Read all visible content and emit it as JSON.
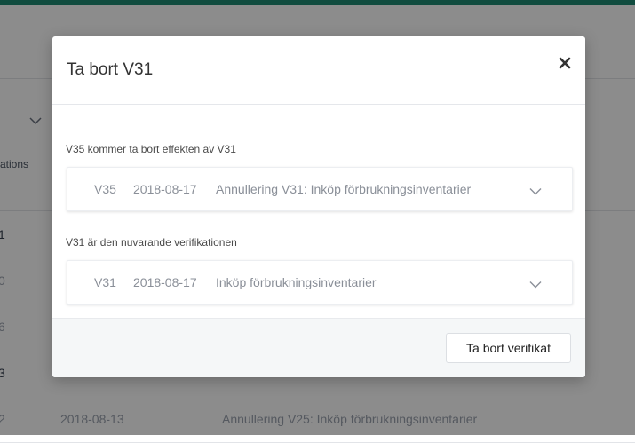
{
  "background": {
    "column_header": "ations",
    "rows": [
      {
        "num": "1",
        "date": "",
        "desc": ""
      },
      {
        "num": "0",
        "date": "",
        "desc": ""
      },
      {
        "num": "6",
        "date": "",
        "desc": ""
      },
      {
        "num": "3",
        "date": "",
        "desc": ""
      },
      {
        "num": "2",
        "date": "2018-08-13",
        "desc": "Annullering V25: Inköp förbrukningsinventarier"
      }
    ]
  },
  "modal": {
    "title": "Ta bort V31",
    "close_icon": "close-icon",
    "section1": {
      "label": "V35 kommer ta bort effekten av V31",
      "entry": {
        "number": "V35",
        "date": "2018-08-17",
        "description": "Annullering V31: Inköp förbrukningsinventarier"
      }
    },
    "section2": {
      "label": "V31 är den nuvarande verifikationen",
      "entry": {
        "number": "V31",
        "date": "2018-08-17",
        "description": "Inköp förbrukningsinventarier"
      }
    },
    "footer": {
      "delete_button": "Ta bort verifikat"
    }
  },
  "colors": {
    "accent": "#1f8a74",
    "overlay": "rgba(0,0,0,0.45)"
  }
}
